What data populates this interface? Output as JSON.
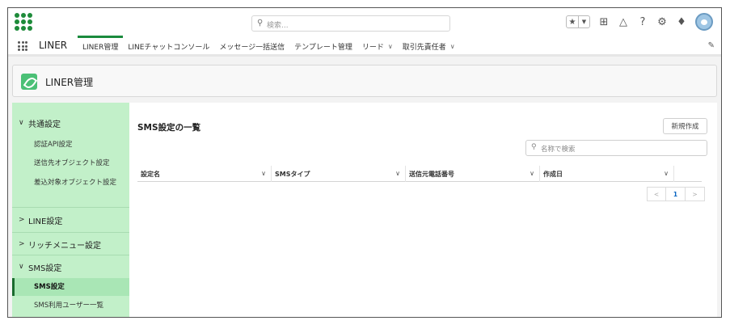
{
  "header": {
    "search_placeholder": "検索..."
  },
  "nav": {
    "app_name": "LINER",
    "items": [
      {
        "label": "LINER管理",
        "active": true,
        "dropdown": false
      },
      {
        "label": "LINEチャットコンソール",
        "active": false,
        "dropdown": false
      },
      {
        "label": "メッセージ一括送信",
        "active": false,
        "dropdown": false
      },
      {
        "label": "テンプレート管理",
        "active": false,
        "dropdown": false
      },
      {
        "label": "リード",
        "active": false,
        "dropdown": true
      },
      {
        "label": "取引先責任者",
        "active": false,
        "dropdown": true
      }
    ]
  },
  "page": {
    "title": "LINER管理"
  },
  "sidebar": {
    "groups": [
      {
        "label": "共通設定",
        "expanded": true,
        "items": [
          "認証API設定",
          "送信先オブジェクト設定",
          "差込対象オブジェクト設定"
        ]
      },
      {
        "label": "LINE設定",
        "expanded": false,
        "items": []
      },
      {
        "label": "リッチメニュー設定",
        "expanded": false,
        "items": []
      },
      {
        "label": "SMS設定",
        "expanded": true,
        "items": [
          "SMS設定",
          "SMS利用ユーザー一覧"
        ],
        "active_item": "SMS設定"
      }
    ]
  },
  "main": {
    "title": "SMS設定の一覧",
    "new_button": "新規作成",
    "search_placeholder": "名称で検索",
    "columns": [
      "設定名",
      "SMSタイプ",
      "送信元電話番号",
      "作成日"
    ],
    "pager": {
      "prev": "<",
      "current": "1",
      "next": ">"
    }
  },
  "colors": {
    "brand_green": "#1e8b3a",
    "sidebar_bg": "#c2f0c9",
    "sidebar_active": "#a9e6b5"
  }
}
